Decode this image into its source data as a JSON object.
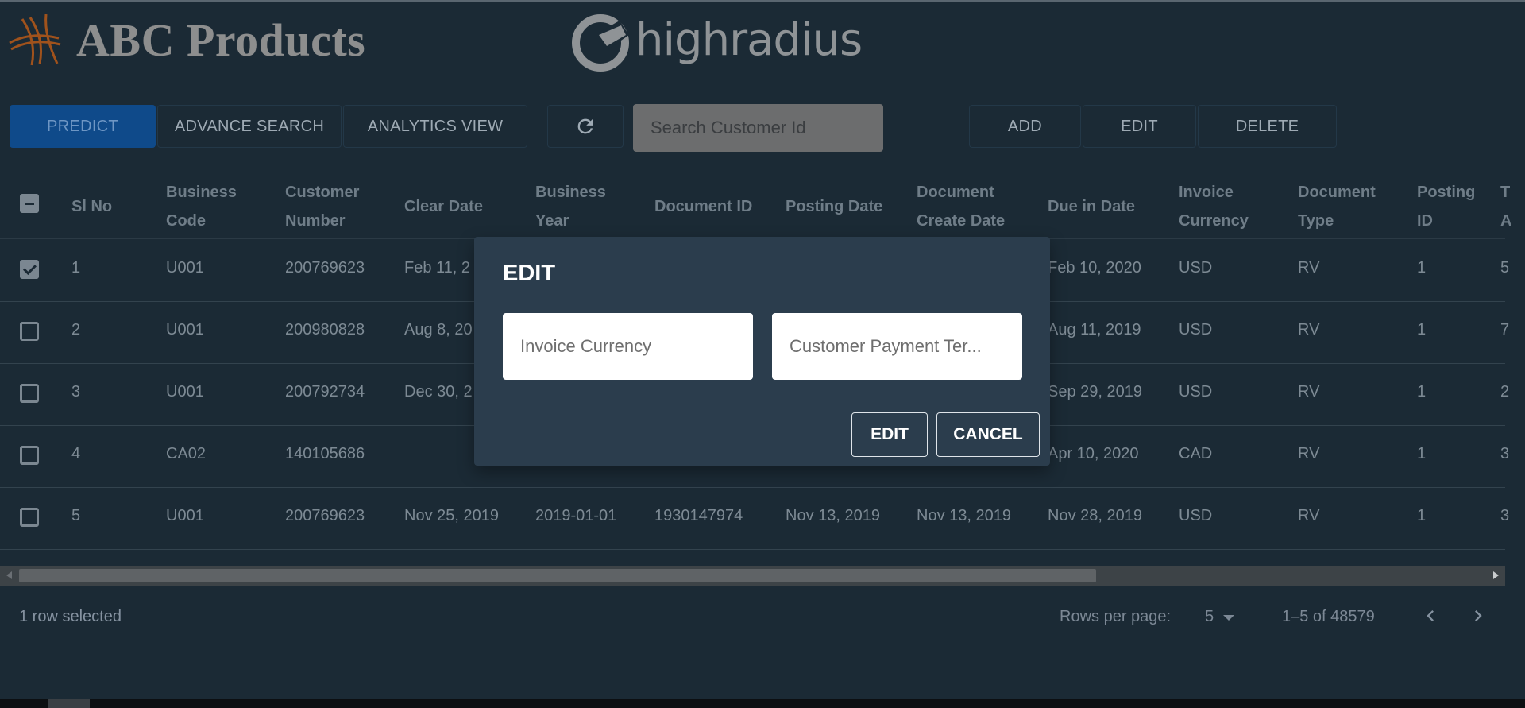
{
  "header": {
    "brand_name": "ABC Products",
    "partner_logo_text": "highradius"
  },
  "toolbar": {
    "predict": "PREDICT",
    "advance_search": "ADVANCE SEARCH",
    "analytics_view": "ANALYTICS VIEW",
    "search_placeholder": "Search Customer Id",
    "add": "ADD",
    "edit": "EDIT",
    "delete": "DELETE"
  },
  "table": {
    "columns": [
      [
        "Sl No"
      ],
      [
        "Business",
        "Code"
      ],
      [
        "Customer",
        "Number"
      ],
      [
        "Clear Date"
      ],
      [
        "Business",
        "Year"
      ],
      [
        "Document ID"
      ],
      [
        "Posting Date"
      ],
      [
        "Document",
        "Create Date"
      ],
      [
        "Due in Date"
      ],
      [
        "Invoice",
        "Currency"
      ],
      [
        "Document",
        "Type"
      ],
      [
        "Posting",
        "ID"
      ],
      [
        "T",
        "A"
      ]
    ],
    "rows": [
      {
        "checked": true,
        "cells": [
          "1",
          "U001",
          "200769623",
          "Feb 11, 2",
          "",
          "",
          "",
          "",
          "Feb 10, 2020",
          "USD",
          "RV",
          "1",
          "5"
        ]
      },
      {
        "checked": false,
        "cells": [
          "2",
          "U001",
          "200980828",
          "Aug 8, 20",
          "",
          "",
          "",
          "",
          "Aug 11, 2019",
          "USD",
          "RV",
          "1",
          "7"
        ]
      },
      {
        "checked": false,
        "cells": [
          "3",
          "U001",
          "200792734",
          "Dec 30, 2",
          "",
          "",
          "",
          "",
          "Sep 29, 2019",
          "USD",
          "RV",
          "1",
          "2"
        ]
      },
      {
        "checked": false,
        "cells": [
          "4",
          "CA02",
          "140105686",
          "",
          "",
          "",
          "",
          "",
          "Apr 10, 2020",
          "CAD",
          "RV",
          "1",
          "3"
        ]
      },
      {
        "checked": false,
        "cells": [
          "5",
          "U001",
          "200769623",
          "Nov 25, 2019",
          "2019-01-01",
          "1930147974",
          "Nov 13, 2019",
          "Nov 13, 2019",
          "Nov 28, 2019",
          "USD",
          "RV",
          "1",
          "3"
        ]
      }
    ]
  },
  "footer": {
    "selected": "1 row selected",
    "rows_per_page_label": "Rows per page:",
    "rows_per_page_value": "5",
    "range": "1–5 of 48579"
  },
  "modal": {
    "title": "EDIT",
    "field1_placeholder": "Invoice Currency",
    "field2_placeholder": "Customer Payment Ter...",
    "edit_button": "EDIT",
    "cancel_button": "CANCEL"
  },
  "icons": {
    "refresh": "refresh-icon",
    "prev": "chevron-left-icon",
    "next": "chevron-right-icon",
    "dropdown": "caret-down-icon"
  },
  "colors": {
    "background": "#1b2a35",
    "primary_button": "#0f4a8a",
    "modal_bg": "#2b3d4d"
  }
}
